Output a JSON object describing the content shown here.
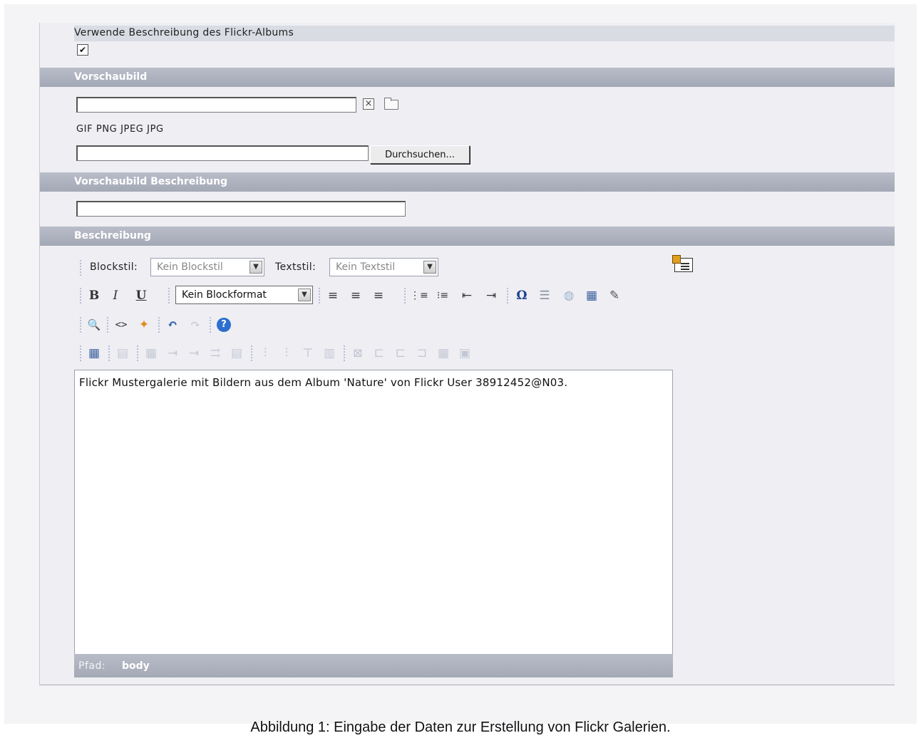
{
  "form": {
    "use_album_description": {
      "label": "Verwende Beschreibung des Flickr-Albums",
      "checked_glyph": "✔",
      "checked": true
    },
    "sections": {
      "thumbnail": "Vorschaubild",
      "thumbnail_description": "Vorschaubild Beschreibung",
      "description": "Beschreibung"
    },
    "thumbnail": {
      "path_value": "",
      "clear_icon": "clear-icon",
      "folder_icon": "folder-icon",
      "allowed_types": "GIF PNG JPEG JPG",
      "upload_value": "",
      "browse_label": "Durchsuchen..."
    },
    "thumbnail_description_value": ""
  },
  "editor": {
    "toolbar1": {
      "blockstyle_label": "Blockstil:",
      "blockstyle_value": "Kein Blockstil",
      "textstyle_label": "Textstil:",
      "textstyle_value": "Kein Textstil"
    },
    "toolbar2": {
      "bold": "B",
      "italic": "I",
      "underline": "U",
      "blockformat_value": "Kein Blockformat",
      "align_left": "≡",
      "align_center": "≡",
      "align_right": "≡",
      "ordered_list": "⋮≡",
      "unordered_list": "⁝≡",
      "outdent": "⇤",
      "indent": "⇥",
      "special_char": "Ω",
      "hr": "☰",
      "image": "◍",
      "table": "▦",
      "paste": "✎"
    },
    "toolbar3": {
      "find": "🔍",
      "code": "<>",
      "cleanup": "✦",
      "undo": "↶",
      "redo": "↷",
      "help": "?"
    },
    "content": "Flickr Mustergalerie mit Bildern aus dem Album 'Nature' von Flickr User 38912452@N03.",
    "status_label": "Pfad:",
    "status_value": "body"
  },
  "caption": "Abbildung 1: Eingabe der Daten zur Erstellung von Flickr Galerien."
}
